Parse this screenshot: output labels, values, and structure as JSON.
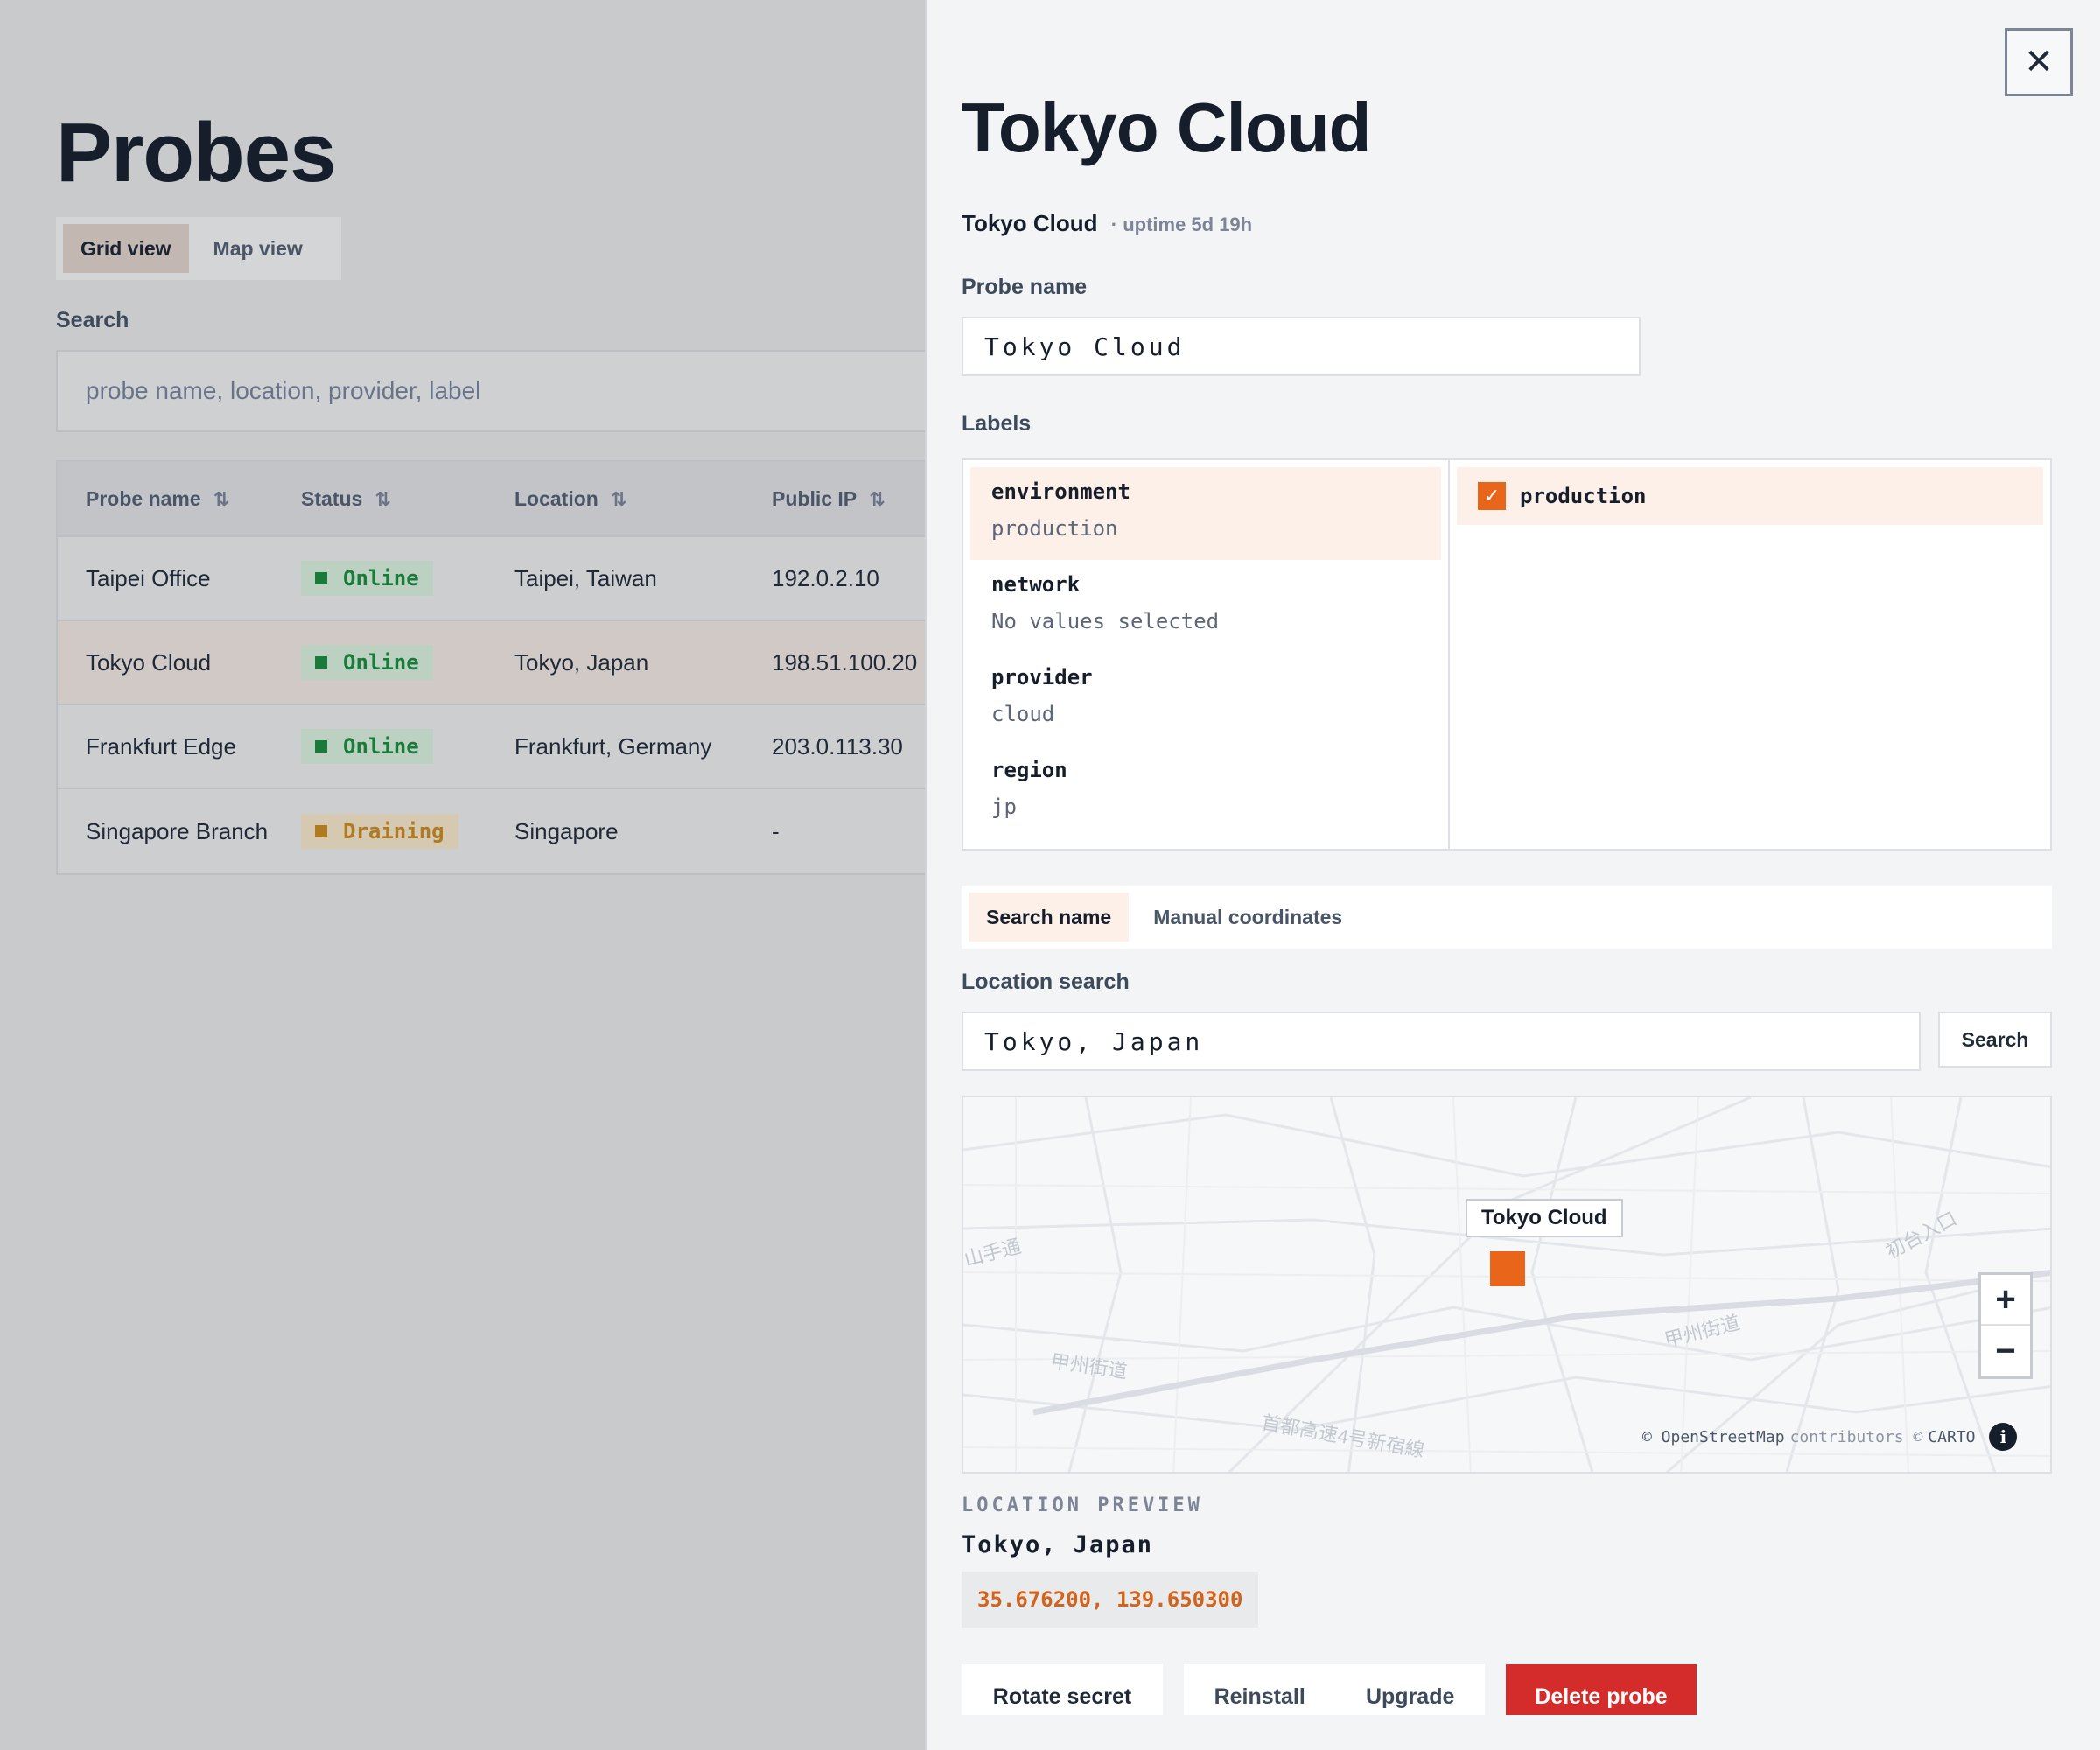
{
  "page": {
    "title": "Probes",
    "view_toggle": {
      "grid": "Grid view",
      "map": "Map view"
    },
    "search": {
      "label": "Search",
      "placeholder": "probe name, location, provider, label"
    },
    "table": {
      "headers": [
        "Probe name",
        "Status",
        "Location",
        "Public IP"
      ],
      "rows": [
        {
          "name": "Taipei Office",
          "status": "Online",
          "location": "Taipei, Taiwan",
          "ip": "192.0.2.10"
        },
        {
          "name": "Tokyo Cloud",
          "status": "Online",
          "location": "Tokyo, Japan",
          "ip": "198.51.100.20"
        },
        {
          "name": "Frankfurt Edge",
          "status": "Online",
          "location": "Frankfurt, Germany",
          "ip": "203.0.113.30"
        },
        {
          "name": "Singapore Branch",
          "status": "Draining",
          "location": "Singapore",
          "ip": "-"
        }
      ]
    }
  },
  "panel": {
    "close_glyph": "✕",
    "title": "Tokyo Cloud",
    "subtitle_name": "Tokyo Cloud",
    "subtitle_uptime": "· uptime 5d 19h",
    "probe_name_label": "Probe name",
    "probe_name_value": "Tokyo Cloud",
    "labels_label": "Labels",
    "labels": [
      {
        "key": "environment",
        "value": "production"
      },
      {
        "key": "network",
        "value": "No values selected"
      },
      {
        "key": "provider",
        "value": "cloud"
      },
      {
        "key": "region",
        "value": "jp"
      }
    ],
    "selected_value": "production",
    "location_tabs": {
      "search": "Search name",
      "manual": "Manual coordinates"
    },
    "location_search_label": "Location search",
    "location_search_value": "Tokyo, Japan",
    "search_button": "Search",
    "map": {
      "marker_label": "Tokyo Cloud",
      "zoom_in": "+",
      "zoom_out": "−",
      "attribution_osm": "© OpenStreetMap",
      "attribution_contrib": "contributors ©",
      "attribution_carto": "CARTO",
      "info_glyph": "i",
      "place_texts": [
        "甲州街道",
        "甲州街道",
        "首都高速4号新宿線",
        "初台入口",
        "山手通"
      ]
    },
    "preview_label": "LOCATION PREVIEW",
    "preview_name": "Tokyo, Japan",
    "coordinates": "35.676200, 139.650300",
    "actions": {
      "rotate": "Rotate secret",
      "reinstall": "Reinstall",
      "upgrade": "Upgrade",
      "delete": "Delete probe"
    }
  },
  "colors": {
    "accent": "#e8651a",
    "danger": "#d42b2b",
    "online": "#1a7a3a",
    "draining": "#b07a22"
  }
}
